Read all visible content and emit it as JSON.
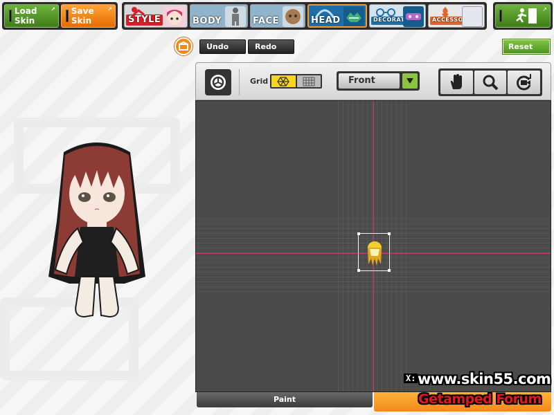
{
  "toolbar": {
    "load_skin": "Load Skin",
    "save_skin": "Save Skin",
    "tabs": {
      "style": "STYLE",
      "body": "BODY",
      "face": "FACE",
      "head": "HEAD",
      "decoration": "DECORATION",
      "accessory": "ACCESSORY"
    },
    "active_tab": "HEAD"
  },
  "history": {
    "undo": "Undo",
    "redo": "Redo",
    "reset": "Reset"
  },
  "editor": {
    "grid_label": "Grid",
    "view": "Front",
    "coord_label": "X:"
  },
  "bottom_tabs": {
    "paint": "Paint"
  },
  "watermark": {
    "url": "www.skin55.com",
    "forum": "Getamped Forum"
  },
  "colors": {
    "accent_orange": "#f08a1c",
    "accent_green": "#6db33b",
    "axis_red": "#d43b6a",
    "canvas_bg": "#4b4b4b"
  }
}
